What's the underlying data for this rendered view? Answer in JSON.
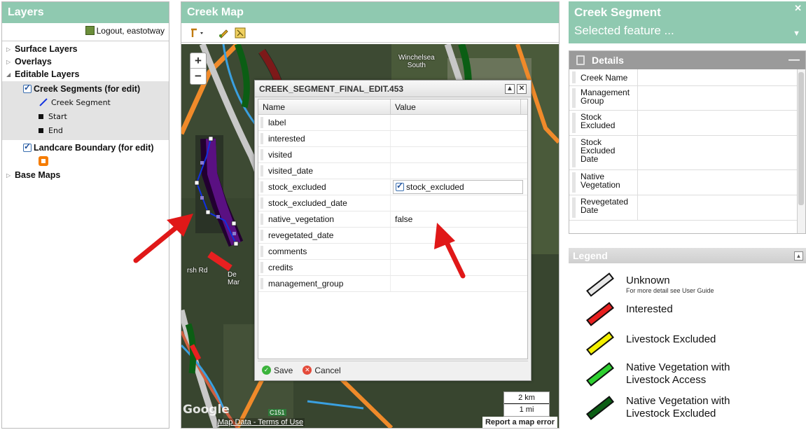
{
  "layers_panel": {
    "title": "Layers",
    "logout_label": "Logout, eastotway",
    "groups": {
      "surface": "Surface Layers",
      "overlays": "Overlays",
      "editable": "Editable Layers",
      "base": "Base Maps"
    },
    "creek_layer": {
      "title": "Creek Segments (for edit)",
      "items": [
        "Creek Segment",
        "Start",
        "End"
      ]
    },
    "landcare_layer": {
      "title": "Landcare Boundary (for edit)"
    }
  },
  "map_panel": {
    "title": "Creek Map",
    "zoom_in": "+",
    "zoom_out": "−",
    "place_labels": {
      "winchelsea": "Winchelsea",
      "south": "South",
      "road": "rsh Rd",
      "c151": "C151",
      "de": "De",
      "mar": "Mar"
    },
    "scale_km": "2 km",
    "scale_mi": "1 mi",
    "report_error": "Report a map error",
    "map_data": "Map Data",
    "terms": "Terms of Use",
    "dash": " - ",
    "google": "Google"
  },
  "dialog": {
    "title": "CREEK_SEGMENT_FINAL_EDIT.453",
    "col_name": "Name",
    "col_value": "Value",
    "rows": [
      {
        "name": "label",
        "value": ""
      },
      {
        "name": "interested",
        "value": ""
      },
      {
        "name": "visited",
        "value": ""
      },
      {
        "name": "visited_date",
        "value": ""
      },
      {
        "name": "stock_excluded",
        "value": "stock_excluded"
      },
      {
        "name": "stock_excluded_date",
        "value": ""
      },
      {
        "name": "native_vegetation",
        "value": "false"
      },
      {
        "name": "revegetated_date",
        "value": ""
      },
      {
        "name": "comments",
        "value": ""
      },
      {
        "name": "credits",
        "value": ""
      },
      {
        "name": "management_group",
        "value": ""
      }
    ],
    "save_label": "Save",
    "cancel_label": "Cancel"
  },
  "segment_panel": {
    "title": "Creek Segment",
    "selected": "Selected feature ...",
    "details_title": "Details",
    "fields": [
      {
        "label": "Creek Name",
        "value": ""
      },
      {
        "label": "Management Group",
        "value": ""
      },
      {
        "label": "Stock Excluded",
        "value": ""
      },
      {
        "label": "Stock Excluded Date",
        "value": ""
      },
      {
        "label": "Native Vegetation",
        "value": ""
      },
      {
        "label": "Revegetated Date",
        "value": ""
      }
    ],
    "legend_title": "Legend",
    "legend": [
      {
        "label": "Unknown",
        "sub": "For more detail see User Guide",
        "color": "#e8e8e8"
      },
      {
        "label": "Interested",
        "sub": "",
        "color": "#e82020"
      },
      {
        "label": "Livestock Excluded",
        "sub": "",
        "color": "#f4f000"
      },
      {
        "label": "Native Vegetation with Livestock Access",
        "sub": "",
        "color": "#2ed030"
      },
      {
        "label": "Native Vegetation with Livestock Excluded",
        "sub": "",
        "color": "#0b5e14"
      }
    ]
  },
  "colors": {
    "header": "#8fc9b0",
    "creek_line": "#1030e0",
    "landcare": "#f57c00",
    "annotation_arrow": "#e01818"
  }
}
